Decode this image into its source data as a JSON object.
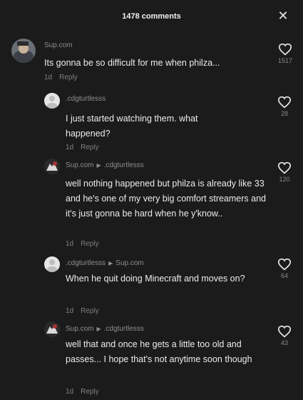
{
  "header": {
    "title": "1478 comments",
    "close_icon": "close-icon"
  },
  "comments": [
    {
      "username": "Sup.com",
      "reply_to": "",
      "text": "Its gonna be so difficult for me when philza...",
      "age": "1d",
      "reply_label": "Reply",
      "likes": "1517"
    },
    {
      "username": ".cdgturtlesss",
      "reply_to": "",
      "text": "I just started watching them. what happened?",
      "age": "1d",
      "reply_label": "Reply",
      "likes": "28"
    },
    {
      "username": "Sup.com",
      "reply_to": ".cdgturtlesss",
      "text": "well nothing happened but philza is already like 33 and he's one of my very big comfort streamers and it's just gonna be hard when he y'know..",
      "age": "1d",
      "reply_label": "Reply",
      "likes": "120"
    },
    {
      "username": ".cdgturtlesss",
      "reply_to": "Sup.com",
      "text": "When he quit doing Minecraft and moves on?",
      "age": "1d",
      "reply_label": "Reply",
      "likes": "64"
    },
    {
      "username": "Sup.com",
      "reply_to": ".cdgturtlesss",
      "text": "well that and once he gets a little too old and passes... I hope that's not anytime soon though",
      "age": "1d",
      "reply_label": "Reply",
      "likes": "43"
    }
  ]
}
